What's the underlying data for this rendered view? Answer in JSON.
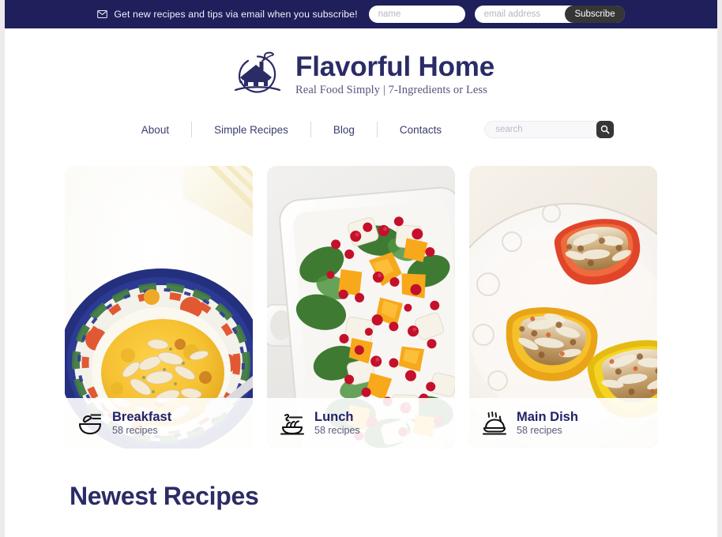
{
  "topbar": {
    "message": "Get new recipes and tips via email when you subscribe!",
    "mail_icon": "envelope-icon",
    "name_placeholder": "name",
    "name_value": "",
    "email_placeholder": "email address",
    "email_value": "",
    "subscribe_label": "Subscribe",
    "background_color": "#1f1f5c",
    "button_color": "#363636"
  },
  "brand": {
    "logo_icon": "house-in-circle-logo",
    "title": "Flavorful Home",
    "tagline": "Real Food Simply | 7-Ingredients or Less",
    "color": "#2b2b66"
  },
  "nav": {
    "items": [
      {
        "label": "About"
      },
      {
        "label": "Simple Recipes"
      },
      {
        "label": "Blog"
      },
      {
        "label": "Contacts"
      }
    ],
    "search": {
      "placeholder": "search",
      "value": "",
      "button_icon": "search-icon"
    }
  },
  "categories": [
    {
      "title": "Breakfast",
      "count": "58 recipes",
      "icon": "bowl-spoon-icon",
      "photo": "yellow-porridge-with-almonds-in-floral-bowl"
    },
    {
      "title": "Lunch",
      "count": "58 recipes",
      "icon": "noodles-icon",
      "photo": "spinach-chicken-orange-pomegranate-salad-in-white-dish"
    },
    {
      "title": "Main Dish",
      "count": "58 recipes",
      "icon": "roast-platter-icon",
      "photo": "stuffed-bell-peppers-on-white-plate"
    }
  ],
  "sections": {
    "newest_recipes_title": "Newest Recipes"
  }
}
